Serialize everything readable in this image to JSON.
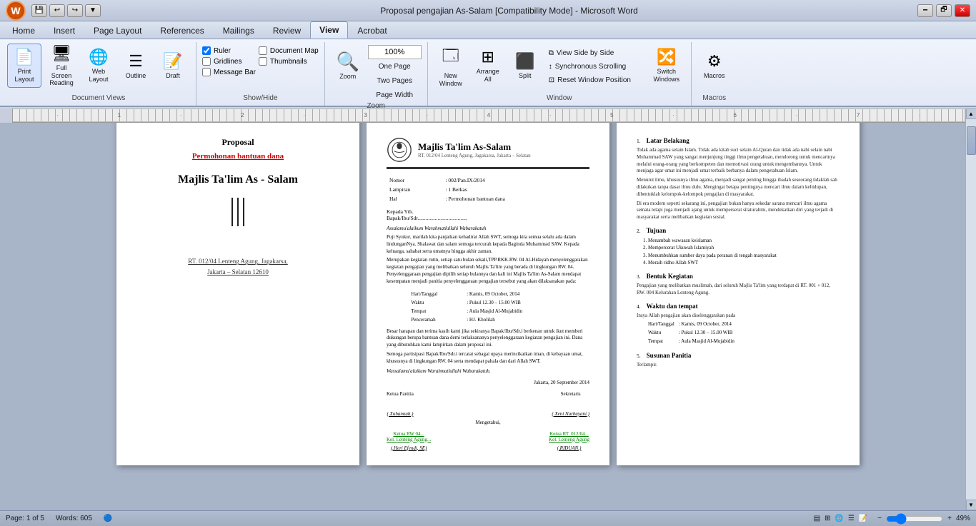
{
  "titlebar": {
    "title": "Proposal pengajian As-Salam [Compatibility Mode] - Microsoft Word",
    "minimize": "🗕",
    "restore": "🗗",
    "close": "✕"
  },
  "tabs": {
    "items": [
      "Home",
      "Insert",
      "Page Layout",
      "References",
      "Mailings",
      "Review",
      "View",
      "Acrobat"
    ],
    "active": "View"
  },
  "ribbon": {
    "groups": {
      "document_views": {
        "label": "Document Views",
        "print_layout": "Print Layout",
        "full_screen": "Full Screen\nReading",
        "web_layout": "Web Layout",
        "outline": "Outline",
        "draft": "Draft"
      },
      "show_hide": {
        "label": "Show/Hide",
        "ruler": "Ruler",
        "gridlines": "Gridlines",
        "message_bar": "Message Bar",
        "document_map": "Document Map",
        "thumbnails": "Thumbnails"
      },
      "zoom": {
        "label": "Zoom",
        "zoom_label": "Zoom",
        "one_page": "One Page",
        "two_pages": "Two Pages",
        "page_width": "Page Width",
        "percent": "100%"
      },
      "window": {
        "label": "Window",
        "new_window": "New Window",
        "arrange_all": "Arrange All",
        "split": "Split",
        "view_side_by_side": "View Side by Side",
        "synchronous_scrolling": "Synchronous Scrolling",
        "reset_window_position": "Reset Window Position",
        "switch_windows": "Switch Windows"
      },
      "macros": {
        "label": "Macros",
        "macros": "Macros"
      }
    }
  },
  "status_bar": {
    "page_info": "Page: 1 of 5",
    "words": "Words: 605",
    "zoom_percent": "49%"
  },
  "page1": {
    "title": "Proposal",
    "subtitle": "Permohonan bantuan dana",
    "org_name": "Majlis Ta'lim As - Salam",
    "address_line1": "RT. 012/04 Lenteng  Agung,  Jagakarsa,",
    "address_line2": "Jakarta – Selatan 12610"
  },
  "page2": {
    "org_name": "Majlis Ta'lim  As-Salam",
    "org_address": "RT. 012/04 Lenteng Agung, Jagakarsa, Jakarta – Selatan",
    "nomor_label": "Nomor",
    "nomor_value": ": 002/Pan.IX/2014",
    "lampiran_label": "Lampiran",
    "lampiran_value": ": 1 Berkas",
    "hal_label": "Hal",
    "hal_value": ": Permohonan bantuan dana",
    "kepada_header": "Kepada Yth.",
    "kepada_name": "Bapak/Ibu/Sdr.",
    "kepada_suffix": "....................................",
    "salutation": "Assalamu'alaikum Warahmatlullahi Wabarakatuh",
    "body1": "Puji Syukur, marilah kita panjatkan kehadirat Allah SWT, semoga kita semua selalu ada dalam lindunganNya. Shalawat dan salam semoga tercurah kepada Baginda Muhammad SAW. Kepada keluarga, sahabat serta umatnya hingga akhir zaman.",
    "body2": "Merupakan kegiatan rutin, setiap satu bulan sekali,TPP.RKK.RW. 04 Al-Hidayah menyelenggarakan kegiatan pengajian yang melibatkan seluruh Majlis Ta'lim yang berada di lingkungan RW. 04. Penyelenggaraan pengajian dipilih setiap bulannya dan kali ini Majlis Ta'lim As-Salam mendapat kesempatan menjadi panitia penyelenggaraan pengajian tersebut yang akan dilaksanakan pada:",
    "hari_label": "Hari/Tanggal",
    "hari_value": ": Kamis, 09 October, 2014",
    "waktu_label": "Waktu",
    "waktu_value": ": Pukul 12.30 – 15.00 WIB",
    "tempat_label": "Tempat",
    "tempat_value": ": Aula Masjid Al-Mujabidin",
    "penceramah_label": "Penceramah",
    "penceramah_value": ": HJ. Kholilah",
    "closing1": "Besar harapan dan terima kasih kami jika sekiranya Bapak/Ibu/Sdr.i berkenan untuk ikut memberi dukungan berupa bantuan dana demi terlaksananya penyelenggaraan kegiatan pengajian ini. Dana yang dibutuhkan kami lampirkan dalam proposal ini.",
    "closing2": "Semoga partisipasi Bapak/Ibu/Sdr.i tercatat sebagai upaya merincikatkan iman, di kebayaan umat, khususnya di lingkungan RW. 04 serta mendapat pahala dan dari Allah SWT.",
    "wassalam": "Wassalamu'alaikum Warahmatlullahi Wabarakatuh.",
    "date_place": "Jakarta, 20 September 2014",
    "ketua_panitia": "Ketua Panitia",
    "sekretaris": "Sekretaris",
    "mengetahui": "Mengetahui,",
    "nama_ketua": "(.Xubannah.)",
    "nama_sekretaris": "(.Xeni Nurbayani.)",
    "ketua_rw": "Ketua RW 04...",
    "kel_lenteng1": "Kel. Lenteng Agung...",
    "ketua_rw2": "Ketua RT. 012/04...",
    "kel_lenteng2": "Kel. Lenteng Agung",
    "nama_heri": "(.Heri Efendi, SE)",
    "nama_riduan": "(.RIDUAN.)"
  },
  "page3": {
    "section1_num": "1.",
    "section1_title": "Latar Belakang",
    "section1_body": "Tidak ada agama selain Islam. Tidak ada kitab suci selain Al-Quran dan tidak ada nabi selain nabi Muhammad SAW yang sangat menjunjung tinggi ilmu pengetahuan, mendorong untuk mencarinya melalui orang-orang yang berkompeten dan memotivasi orang untuk mengembannya. Untuk menjaga agar umat ini menjadi umat terbaik berbanya dalam pengetahuan Islam.",
    "section1_body2": "Menurut ilmu, khususnya ilmu agama, menjadi sangat penting hingga ibadah seseorang tidaklah sah dilakukan tanpa dasar ilmu dulu. Mengingat betapa pentingnya mencari ilmu dalam kehidupan, dibentuklah kelompok-kelompok pengajian di masyarakat.",
    "section1_body3": "Di era modern seperti sekarang ini, pengajian bukan hanya sekedar sarana mencari ilmu agama semata tetapi juga menjadi ajang untuk memperserat silaturahmi, mendekatkan diri yang terjadi di masyarakat serta melibatkan kegiatan sosial.",
    "section2_num": "2.",
    "section2_title": "Tujuan",
    "tujuan1": "Menambah wawasan keislaman",
    "tujuan2": "Mempercerat Ukuwah Islamiyah",
    "tujuan3": "Menumbuhkan sumber daya pada peranan di tengah masyarakat",
    "tujuan4": "Meraih ridho Allah SWT",
    "section3_num": "3.",
    "section3_title": "Bentuk Kegiatan",
    "section3_body": "Pengajian yang melibatkan muslimah, dari seluruh Majlis Ta'lim yang terdapat di RT. 001 + 012, RW. 004 Kelurahan Lenteng Agung.",
    "section4_num": "4.",
    "section4_title": "Waktu dan tempat",
    "section4_intro": "Insya Allah pengajian akan diselenggarakan pada",
    "s4_hari_label": "Hari/Tanggal",
    "s4_hari_value": ": Kamis, 09 October, 2014",
    "s4_waktu_label": "Waktu",
    "s4_waktu_value": ": Pukul 12.30 – 15.00 WIB",
    "s4_tempat_label": "Tempat",
    "s4_tempat_value": ": Aula Masjid Al-Mujabidin",
    "section5_num": "5.",
    "section5_title": "Susunan Panitia",
    "section5_body": "Terlampir."
  }
}
